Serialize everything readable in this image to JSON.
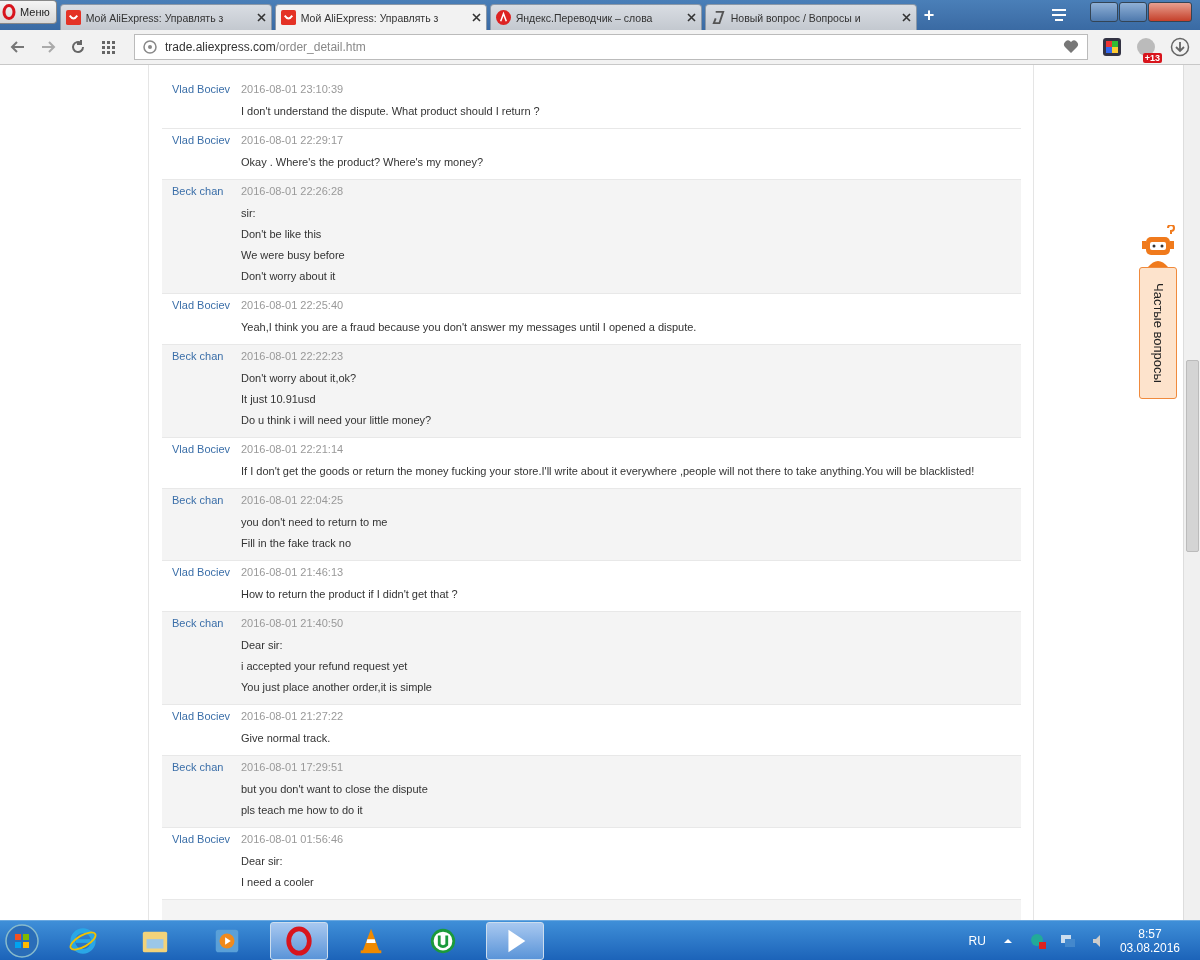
{
  "browser": {
    "menu_label": "Меню",
    "tabs": [
      {
        "title": "Мой AliExpress: Управлять з",
        "selected": false,
        "kind": "ali"
      },
      {
        "title": "Мой AliExpress: Управлять з",
        "selected": true,
        "kind": "ali"
      },
      {
        "title": "Яндекс.Переводчик – слова",
        "selected": false,
        "kind": "yandex"
      },
      {
        "title": "Новый вопрос / Вопросы и",
        "selected": false,
        "kind": "answers"
      }
    ],
    "new_tab": "+",
    "url_host": "trade.aliexpress.com",
    "url_path": "/order_detail.htm",
    "extension_badge": "+13"
  },
  "messages": [
    {
      "author": "Vlad Bociev",
      "kind": "buyer",
      "time": "2016-08-01 23:10:39",
      "lines": [
        "I don't understand the dispute. What product should I return ?"
      ]
    },
    {
      "author": "Vlad Bociev",
      "kind": "buyer",
      "time": "2016-08-01 22:29:17",
      "lines": [
        "Okay . Where's the product? Where's my money?"
      ]
    },
    {
      "author": "Beck chan",
      "kind": "seller",
      "time": "2016-08-01 22:26:28",
      "lines": [
        "sir:",
        "Don't be like this",
        "We were busy before",
        "Don't worry about it"
      ]
    },
    {
      "author": "Vlad Bociev",
      "kind": "buyer",
      "time": "2016-08-01 22:25:40",
      "lines": [
        "Yeah,I think you are a fraud because you don't answer my messages until I opened a dispute."
      ]
    },
    {
      "author": "Beck chan",
      "kind": "seller",
      "time": "2016-08-01 22:22:23",
      "lines": [
        "Don't worry about it,ok?",
        "It just 10.91usd",
        "Do u think i will need your little money?"
      ]
    },
    {
      "author": "Vlad Bociev",
      "kind": "buyer",
      "time": "2016-08-01 22:21:14",
      "lines": [
        "If I don't get the goods or return the money fucking your store.I'll write about it everywhere ,people will not there to take anything.You will be blacklisted!"
      ]
    },
    {
      "author": "Beck chan",
      "kind": "seller",
      "time": "2016-08-01 22:04:25",
      "lines": [
        "you don't need to return to me",
        "Fill in the fake track no"
      ]
    },
    {
      "author": "Vlad Bociev",
      "kind": "buyer",
      "time": "2016-08-01 21:46:13",
      "lines": [
        "How to return the product if I didn't get that ?"
      ]
    },
    {
      "author": "Beck chan",
      "kind": "seller",
      "time": "2016-08-01 21:40:50",
      "lines": [
        "Dear sir:",
        "i accepted your refund request yet",
        "You just place another order,it is simple"
      ]
    },
    {
      "author": "Vlad Bociev",
      "kind": "buyer",
      "time": "2016-08-01 21:27:22",
      "lines": [
        "Give normal track."
      ]
    },
    {
      "author": "Beck chan",
      "kind": "seller",
      "time": "2016-08-01 17:29:51",
      "lines": [
        "but you don't want to close the dispute",
        "pls teach me how to do it"
      ]
    },
    {
      "author": "Vlad Bociev",
      "kind": "buyer",
      "time": "2016-08-01 01:56:46",
      "lines": [
        "Dear sir:",
        "I need a cooler"
      ]
    }
  ],
  "help_widget": {
    "label": "Частые вопросы"
  },
  "taskbar": {
    "apps": [
      {
        "kind": "ie",
        "selected": false
      },
      {
        "kind": "folder",
        "selected": false
      },
      {
        "kind": "media",
        "selected": false
      },
      {
        "kind": "opera",
        "selected": true
      },
      {
        "kind": "vlc",
        "selected": false
      },
      {
        "kind": "torrent",
        "selected": false
      },
      {
        "kind": "player",
        "selected": true
      }
    ],
    "language": "RU",
    "time": "8:57",
    "date": "03.08.2016"
  }
}
